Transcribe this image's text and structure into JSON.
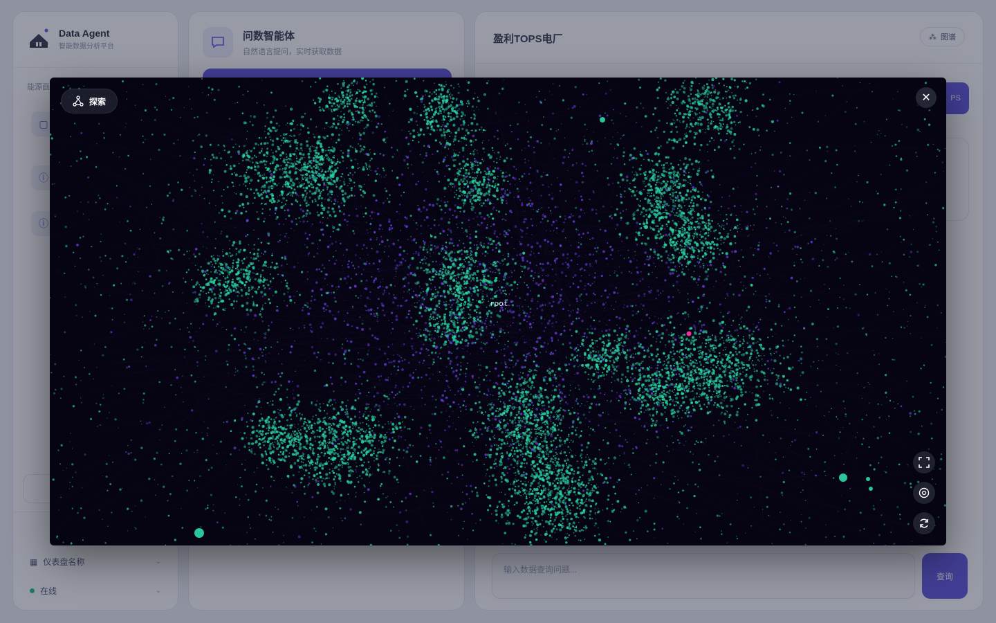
{
  "app": {
    "brand_title": "Data Agent",
    "brand_subtitle": "智能数据分析平台",
    "sidebar": {
      "section_label": "能源画",
      "bottom_item_1": "仪表盘名称",
      "bottom_item_2": "在线"
    },
    "middle": {
      "title": "问数智能体",
      "subtitle": "自然语言提问，实时获取数据"
    },
    "main": {
      "title": "盈利TOPS电厂",
      "graph_button_label": "图谱",
      "accent_button_label": "PS",
      "input_placeholder": "输入数据查询问题...",
      "send_button_label": "查询"
    }
  },
  "modal": {
    "explore_label": "探索",
    "root_node_label": "root",
    "close_icon": "close-icon",
    "controls": [
      "fullscreen-icon",
      "focus-icon",
      "refresh-icon"
    ],
    "colors": {
      "background": "#060413",
      "cluster_node": "#2ad1a0",
      "hub_node": "#6a3ee0",
      "highlight_node": "#ff2fa0"
    }
  }
}
